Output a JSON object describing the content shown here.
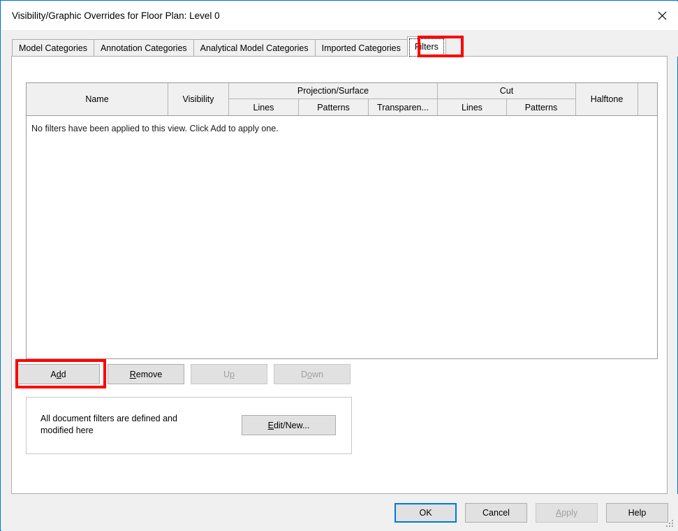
{
  "window": {
    "title": "Visibility/Graphic Overrides for Floor Plan: Level 0",
    "close_icon": "close-icon",
    "accent_color": "#0078d7",
    "annotation_color": "#ff0000"
  },
  "tabs": [
    {
      "label": "Model Categories",
      "active": false
    },
    {
      "label": "Annotation Categories",
      "active": false
    },
    {
      "label": "Analytical Model Categories",
      "active": false
    },
    {
      "label": "Imported Categories",
      "active": false
    },
    {
      "label": "Filters",
      "active": true
    }
  ],
  "table": {
    "group_headers": [
      {
        "label": "Name"
      },
      {
        "label": "Visibility"
      },
      {
        "label": "Projection/Surface"
      },
      {
        "label": "Cut"
      },
      {
        "label": "Halftone"
      }
    ],
    "sub_headers": [
      {
        "label": "Lines"
      },
      {
        "label": "Patterns"
      },
      {
        "label": "Transparen..."
      },
      {
        "label": "Lines"
      },
      {
        "label": "Patterns"
      }
    ],
    "empty_message": "No filters have been applied to this view. Click Add to apply one.",
    "rows": []
  },
  "actions": {
    "add": {
      "label": "Add",
      "accel": "d",
      "enabled": true,
      "highlighted": true
    },
    "remove": {
      "label": "Remove",
      "accel": "R",
      "enabled": true,
      "highlighted": false
    },
    "up": {
      "label": "Up",
      "accel": "p",
      "enabled": false,
      "highlighted": false
    },
    "down": {
      "label": "Down",
      "accel": "o",
      "enabled": false,
      "highlighted": false
    }
  },
  "editnew": {
    "description_line1": "All document filters are defined and",
    "description_line2": "modified here",
    "button_label": "Edit/New...",
    "button_accel": "E"
  },
  "footer": {
    "ok": {
      "label": "OK",
      "enabled": true,
      "default": true
    },
    "cancel": {
      "label": "Cancel",
      "enabled": true,
      "default": false
    },
    "apply": {
      "label": "Apply",
      "accel": "A",
      "enabled": false,
      "default": false
    },
    "help": {
      "label": "Help",
      "enabled": true,
      "default": false
    },
    "resize_grip": "resize-grip-icon"
  }
}
